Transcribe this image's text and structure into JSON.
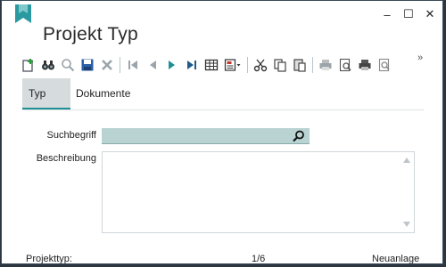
{
  "window": {
    "title": "Projekt Typ",
    "controls": {
      "minimize": "–",
      "maximize": "☐",
      "close": "✕"
    }
  },
  "toolbar": {
    "items": [
      "new-icon",
      "search-binoculars-icon",
      "magnifier-icon",
      "save-icon",
      "delete-icon",
      "first-record-icon",
      "prev-record-icon",
      "next-record-icon",
      "last-record-icon",
      "table-view-icon",
      "form-layout-icon",
      "cut-icon",
      "copy-icon",
      "paste-icon",
      "print-icon",
      "print-preview-icon",
      "print-setup-icon",
      "preview-zoom-icon"
    ],
    "more": "»"
  },
  "tabs": [
    {
      "label": "Typ",
      "active": true
    },
    {
      "label": "Dokumente",
      "active": false
    }
  ],
  "form": {
    "suchbegriff_label": "Suchbegriff",
    "suchbegriff_value": "",
    "beschreibung_label": "Beschreibung",
    "beschreibung_value": ""
  },
  "status": {
    "left": "Projekttyp:",
    "record": "1/6",
    "mode": "Neuanlage"
  },
  "colors": {
    "accent": "#1f8f94",
    "search_bg": "#b9d2d2",
    "tab_active_bg": "#d6dbdd"
  }
}
